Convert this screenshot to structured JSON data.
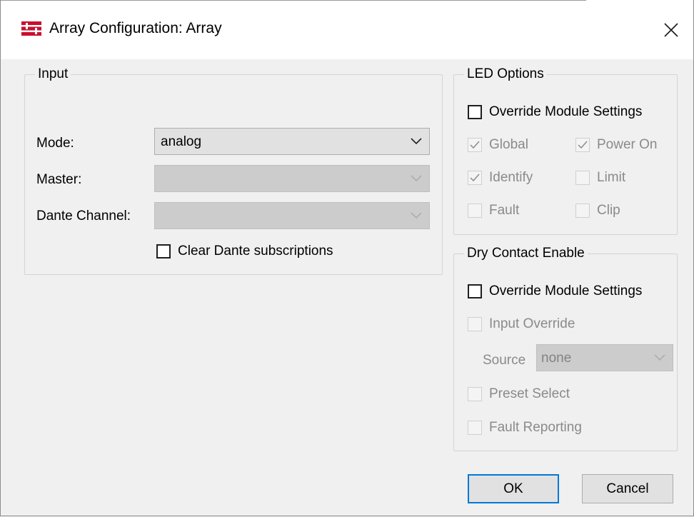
{
  "window": {
    "title": "Array Configuration: Array",
    "app_icon": "array-config-icon",
    "close_icon": "close-icon"
  },
  "input_group": {
    "legend": "Input",
    "mode_label": "Mode:",
    "mode_value": "analog",
    "master_label": "Master:",
    "master_value": "",
    "dante_channel_label": "Dante Channel:",
    "dante_channel_value": "",
    "clear_dante_label": "Clear Dante subscriptions",
    "clear_dante_checked": false
  },
  "led_options": {
    "legend": "LED Options",
    "override_label": "Override Module Settings",
    "override_checked": false,
    "global_label": "Global",
    "global_checked": true,
    "power_on_label": "Power On",
    "power_on_checked": true,
    "identify_label": "Identify",
    "identify_checked": true,
    "limit_label": "Limit",
    "limit_checked": false,
    "fault_label": "Fault",
    "fault_checked": false,
    "clip_label": "Clip",
    "clip_checked": false
  },
  "dry_contact": {
    "legend": "Dry Contact Enable",
    "override_label": "Override Module Settings",
    "override_checked": false,
    "input_override_label": "Input Override",
    "input_override_checked": false,
    "source_label": "Source",
    "source_value": "none",
    "preset_select_label": "Preset Select",
    "preset_select_checked": false,
    "fault_reporting_label": "Fault Reporting",
    "fault_reporting_checked": false
  },
  "buttons": {
    "ok": "OK",
    "cancel": "Cancel"
  },
  "colors": {
    "accent": "#0078d7",
    "icon_red": "#c8102e"
  }
}
